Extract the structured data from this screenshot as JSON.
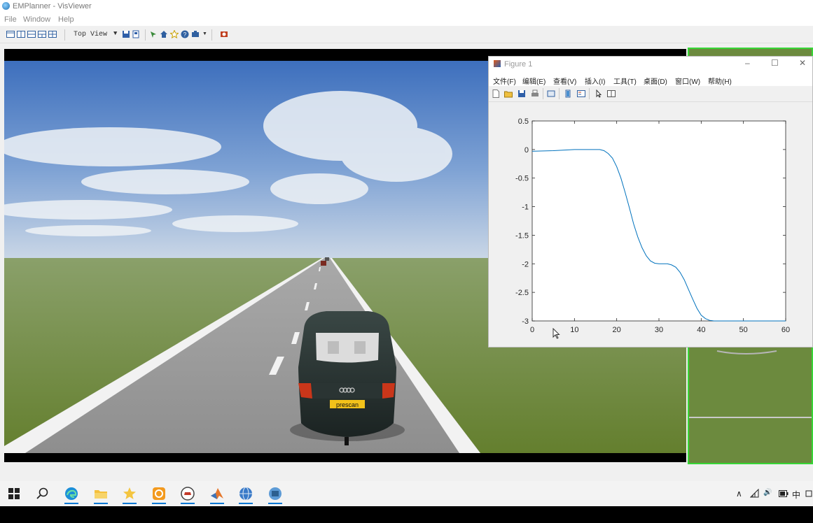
{
  "app": {
    "title": "EMPlanner - VisViewer",
    "menu": [
      "File",
      "Window",
      "Help"
    ],
    "toolbar": {
      "view_mode": "Top View"
    }
  },
  "figure": {
    "title": "Figure 1",
    "menu": [
      "文件(F)",
      "编辑(E)",
      "查看(V)",
      "插入(I)",
      "工具(T)",
      "桌面(D)",
      "窗口(W)",
      "帮助(H)"
    ],
    "window_controls": {
      "minimize": "–",
      "maximize": "☐",
      "close": "✕"
    }
  },
  "chart_data": {
    "type": "line",
    "title": "",
    "xlabel": "",
    "ylabel": "",
    "xlim": [
      0,
      60
    ],
    "ylim": [
      -3,
      0.5
    ],
    "xticks": [
      0,
      10,
      20,
      30,
      40,
      50,
      60
    ],
    "yticks": [
      0.5,
      0,
      -0.5,
      -1,
      -1.5,
      -2,
      -2.5,
      -3
    ],
    "yticklabels": [
      "0.5",
      "0",
      "-0.5",
      "-1",
      "-1.5",
      "-2",
      "-2.5",
      "-3"
    ],
    "grid": false,
    "color": "#0072bd",
    "series": [
      {
        "x": [
          0,
          5,
          10,
          14,
          16,
          17,
          18,
          19,
          20,
          21,
          22,
          23,
          24,
          25,
          26,
          27,
          28,
          29,
          30,
          31,
          32,
          33,
          34,
          35,
          36,
          37,
          38,
          39,
          40,
          41,
          42,
          43,
          44,
          45,
          50,
          55,
          60
        ],
        "values": [
          -0.03,
          -0.02,
          0,
          0,
          0,
          -0.02,
          -0.07,
          -0.15,
          -0.3,
          -0.5,
          -0.75,
          -1.02,
          -1.3,
          -1.53,
          -1.72,
          -1.86,
          -1.95,
          -1.99,
          -2.0,
          -2.0,
          -2.0,
          -2.02,
          -2.06,
          -2.15,
          -2.28,
          -2.45,
          -2.62,
          -2.78,
          -2.9,
          -2.96,
          -2.99,
          -3.0,
          -3.0,
          -3.0,
          -3.0,
          -3.0,
          -3.0
        ]
      }
    ]
  },
  "scene": {
    "plate_text": "prescan"
  },
  "taskbar": {
    "apps": [
      "start-icon",
      "search-icon",
      "edge-icon",
      "file-explorer-icon",
      "favorites-app-icon",
      "orange-app-icon",
      "car-app-icon",
      "matlab-icon",
      "globe-app-icon",
      "visviewer-icon"
    ],
    "tray": {
      "chevron": "∧",
      "volume": "🔊",
      "ime": "中"
    }
  }
}
